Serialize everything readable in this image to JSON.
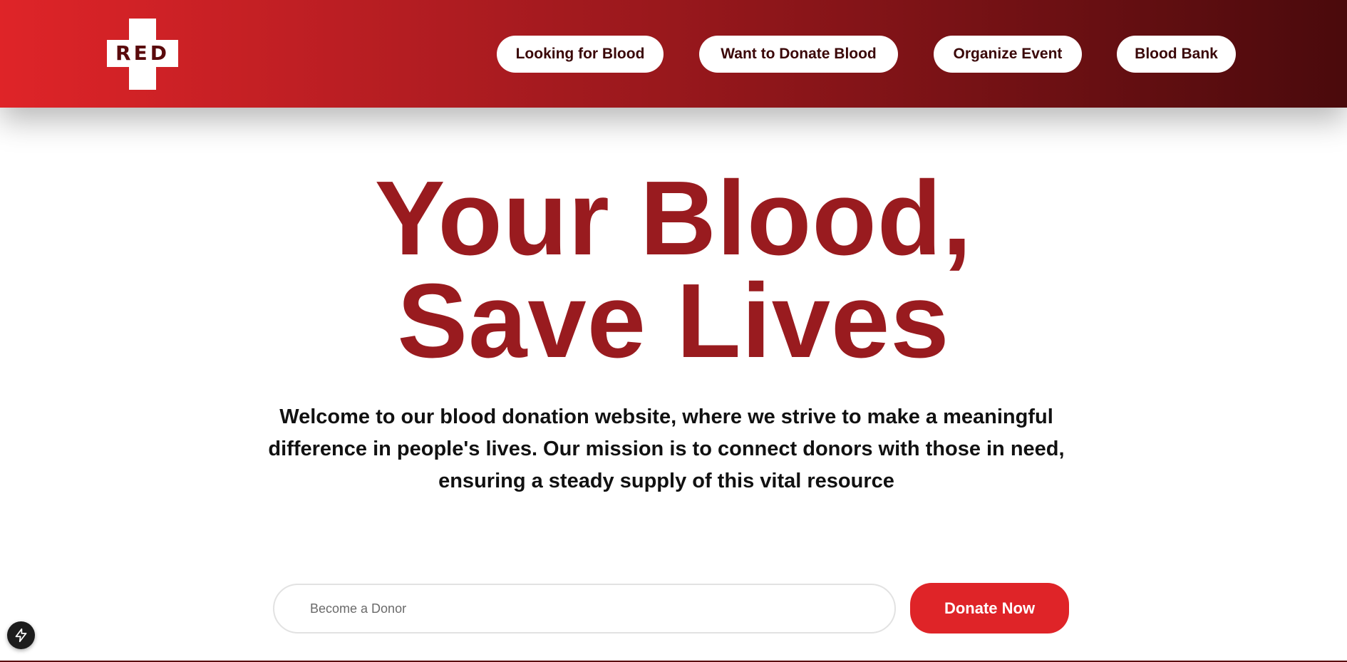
{
  "header": {
    "logo_text": "RED",
    "nav": [
      {
        "label": "Looking for Blood"
      },
      {
        "label": "Want to Donate Blood"
      },
      {
        "label": "Organize Event"
      },
      {
        "label": "Blood Bank"
      }
    ]
  },
  "hero": {
    "title_line1": "Your Blood,",
    "title_line2": "Save Lives",
    "description": "Welcome to our blood donation website, where we strive to make a meaningful difference in people's lives. Our mission is to connect donors with those in need, ensuring a steady supply of this vital resource"
  },
  "donor_form": {
    "input_placeholder": "Become a Donor",
    "input_value": "",
    "button_label": "Donate Now"
  },
  "floating": {
    "icon": "lightning-bolt-icon"
  },
  "colors": {
    "brand_red": "#df2428",
    "title_red": "#991b1f",
    "header_dark": "#4a0a0c",
    "nav_text": "#3a0708"
  }
}
